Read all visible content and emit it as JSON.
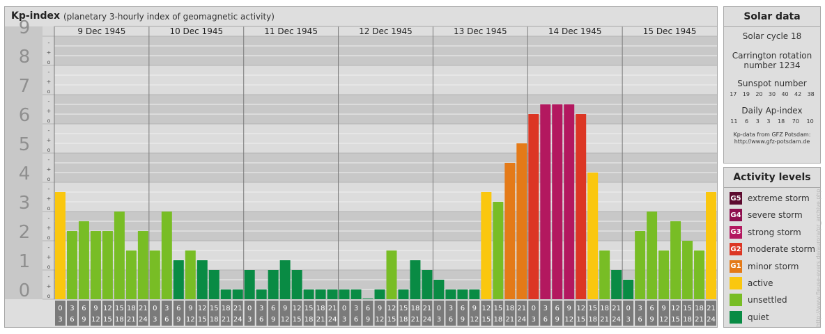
{
  "header": {
    "title": "Kp-index",
    "subtitle": "(planetary 3-hourly index of geomagnetic activity)"
  },
  "chart_data": {
    "type": "bar",
    "ylim": [
      0,
      9
    ],
    "y_ticks": [
      "0",
      "1",
      "2",
      "3",
      "4",
      "5",
      "6",
      "7",
      "8",
      "9"
    ],
    "minor_tick_labels": [
      "o",
      "+",
      "-"
    ],
    "days": [
      "9 Dec 1945",
      "10 Dec 1945",
      "11 Dec 1945",
      "12 Dec 1945",
      "13 Dec 1945",
      "14 Dec 1945",
      "15 Dec 1945"
    ],
    "interval_start_labels": [
      "0",
      "3",
      "6",
      "9",
      "12",
      "15",
      "18",
      "21"
    ],
    "interval_end_labels": [
      "3",
      "6",
      "9",
      "12",
      "15",
      "18",
      "21",
      "24"
    ],
    "values": [
      3.667,
      2.333,
      2.667,
      2.333,
      2.333,
      3.0,
      1.667,
      2.333,
      1.667,
      3.0,
      1.333,
      1.667,
      1.333,
      1.0,
      0.333,
      0.333,
      1.0,
      0.333,
      1.0,
      1.333,
      1.0,
      0.333,
      0.333,
      0.333,
      0.333,
      0.333,
      0.0,
      0.333,
      1.667,
      0.333,
      1.333,
      1.0,
      0.667,
      0.333,
      0.333,
      0.333,
      3.667,
      3.333,
      4.667,
      5.333,
      6.333,
      6.667,
      6.667,
      6.667,
      6.333,
      4.333,
      1.667,
      1.0,
      0.667,
      2.333,
      3.0,
      1.667,
      2.667,
      2.0,
      1.667,
      3.667
    ],
    "level_colors": {
      "quiet": "#098b44",
      "unsettled": "#78bd25",
      "active": "#fac70f",
      "G1": "#e47a18",
      "G2": "#dc3624",
      "G3": "#b3185f",
      "G4": "#8e0f4e",
      "G5": "#5c0a2e"
    }
  },
  "solar": {
    "heading": "Solar data",
    "cycle": "Solar cycle 18",
    "carrington_line1": "Carrington rotation",
    "carrington_line2": "number 1234",
    "sunspot_label": "Sunspot number",
    "sunspot_values": [
      "17",
      "19",
      "20",
      "30",
      "40",
      "42",
      "38"
    ],
    "ap_label": "Daily Ap-index",
    "ap_values": [
      "11",
      "6",
      "3",
      "3",
      "18",
      "70",
      "10"
    ],
    "source_line1": "Kp-data from GFZ Potsdam:",
    "source_line2": "http://www.gfz-potsdam.de"
  },
  "activity": {
    "heading": "Activity levels",
    "items": [
      {
        "badge": "G5",
        "label": "extreme storm",
        "color": "#5c0a2e"
      },
      {
        "badge": "G4",
        "label": "severe storm",
        "color": "#8e0f4e"
      },
      {
        "badge": "G3",
        "label": "strong storm",
        "color": "#b3185f"
      },
      {
        "badge": "G2",
        "label": "moderate storm",
        "color": "#dc3624"
      },
      {
        "badge": "G1",
        "label": "minor storm",
        "color": "#e47a18"
      },
      {
        "badge": "",
        "label": "active",
        "color": "#fac70f"
      },
      {
        "badge": "",
        "label": "unsettled",
        "color": "#78bd25"
      },
      {
        "badge": "",
        "label": "quiet",
        "color": "#098b44"
      }
    ]
  },
  "credit": "http://www.fleuse-evers.de/aurora/pr_archive.php"
}
